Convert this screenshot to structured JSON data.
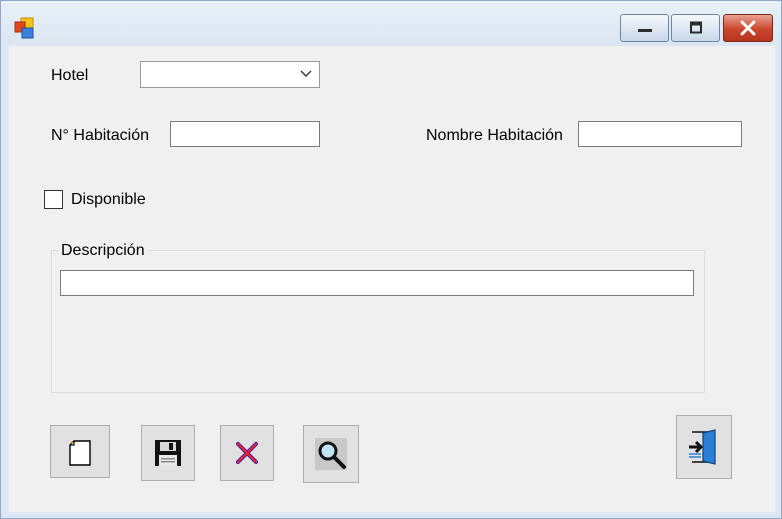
{
  "window": {
    "icons": {
      "app": "windows-forms-app-icon",
      "minimize": "minimize-icon",
      "maximize": "maximize-icon",
      "close": "close-icon"
    }
  },
  "form": {
    "hotel_label": "Hotel",
    "hotel_value": "",
    "room_number_label": "N° Habitación",
    "room_number_value": "",
    "room_name_label": "Nombre Habitación",
    "room_name_value": "",
    "available_label": "Disponible",
    "available_checked": false,
    "description_group_label": "Descripción",
    "description_value": ""
  },
  "toolbar": {
    "buttons": [
      {
        "name": "new-button",
        "icon": "new-document-icon"
      },
      {
        "name": "save-button",
        "icon": "floppy-disk-icon"
      },
      {
        "name": "delete-button",
        "icon": "red-x-icon"
      },
      {
        "name": "search-button",
        "icon": "magnifier-icon"
      },
      {
        "name": "exit-button",
        "icon": "exit-door-icon"
      }
    ]
  },
  "colors": {
    "client_bg": "#f0f0f0",
    "close_button": "#c9452b",
    "titlebar": "#dde7f3"
  }
}
